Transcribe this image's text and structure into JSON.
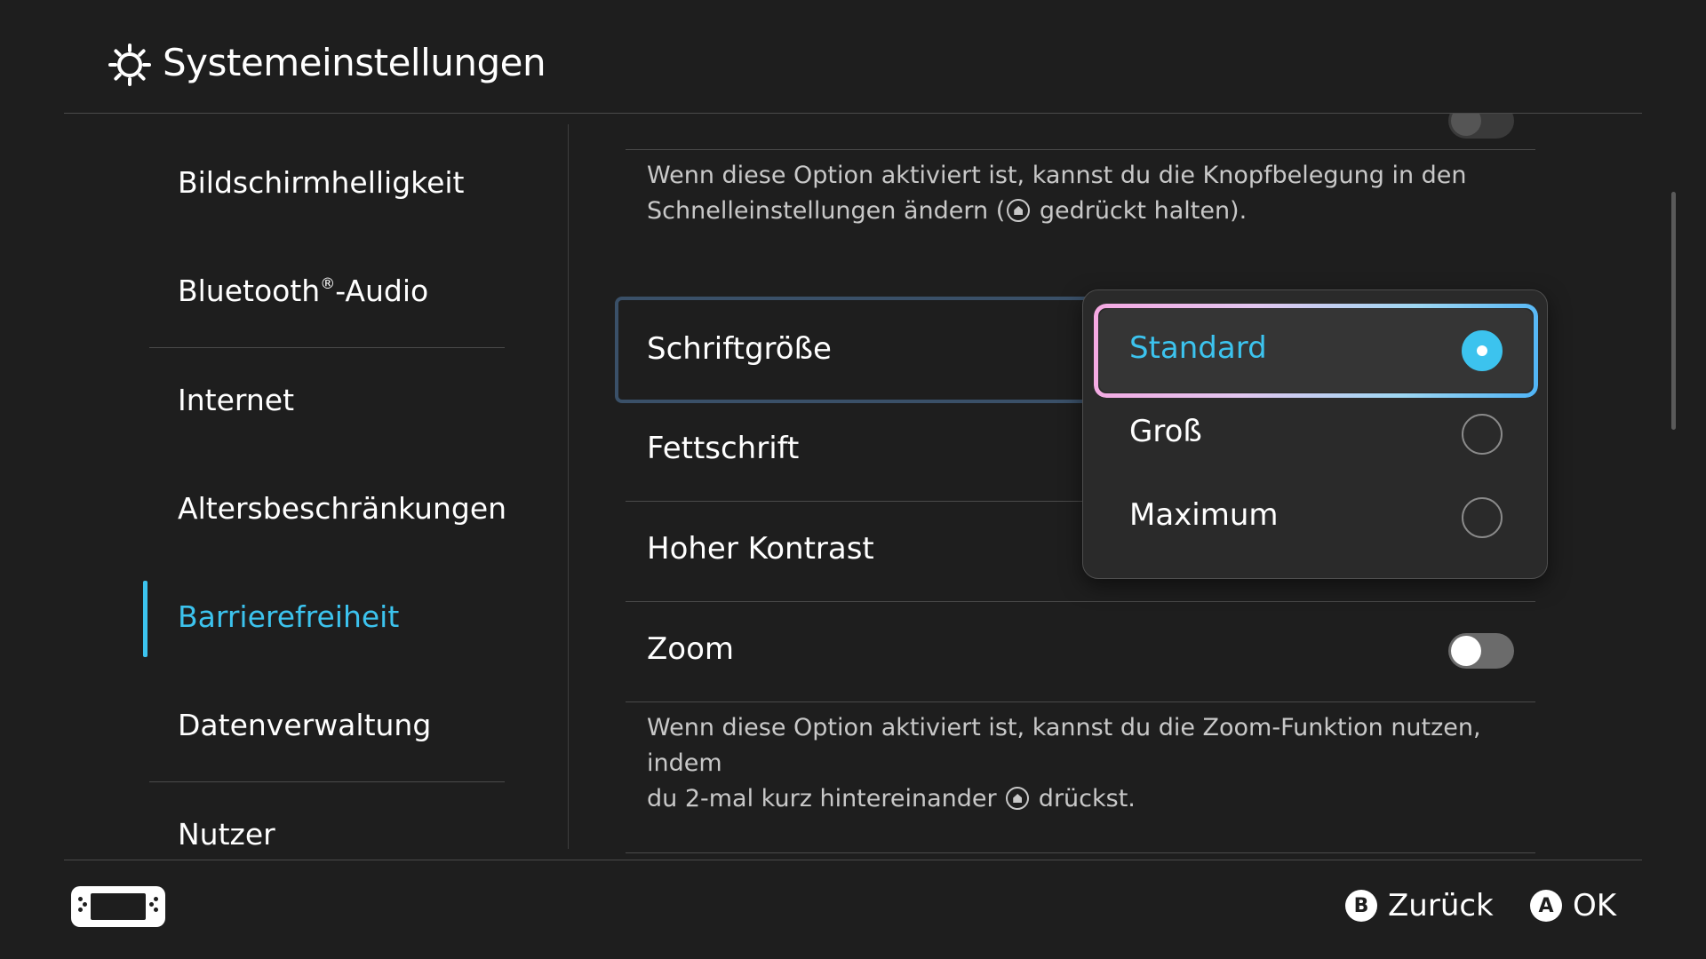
{
  "header": {
    "title": "Systemeinstellungen",
    "icon": "gear-icon"
  },
  "sidebar": {
    "items": [
      {
        "label": "Bildschirmhelligkeit",
        "active": false
      },
      {
        "label": "Bluetooth",
        "suffix": "-Audio",
        "sup": "®",
        "active": false
      },
      {
        "label": "Internet",
        "active": false
      },
      {
        "label": "Altersbeschränkungen",
        "active": false
      },
      {
        "label": "Barrierefreiheit",
        "active": true
      },
      {
        "label": "Datenverwaltung",
        "active": false
      },
      {
        "label": "Nutzer",
        "active": false
      }
    ]
  },
  "main": {
    "button_mapping_desc_1": "Wenn diese Option aktiviert ist, kannst du die Knopfbelegung in den",
    "button_mapping_desc_2a": "Schnelleinstellungen ändern (",
    "button_mapping_desc_2b": " gedrückt halten).",
    "rows": [
      {
        "label": "Schriftgröße"
      },
      {
        "label": "Fettschrift"
      },
      {
        "label": "Hoher Kontrast"
      },
      {
        "label": "Zoom",
        "toggle": false
      }
    ],
    "zoom_desc_1": "Wenn diese Option aktiviert ist, kannst du die Zoom-Funktion nutzen, indem",
    "zoom_desc_2a": "du 2-mal kurz hintereinander ",
    "zoom_desc_2b": " drückst."
  },
  "dropdown": {
    "options": [
      {
        "label": "Standard",
        "selected": true
      },
      {
        "label": "Groß",
        "selected": false
      },
      {
        "label": "Maximum",
        "selected": false
      }
    ]
  },
  "footer": {
    "back_key": "B",
    "back_label": "Zurück",
    "ok_key": "A",
    "ok_label": "OK"
  },
  "colors": {
    "accent": "#3cc3ee",
    "background": "#1e1e1e",
    "divider": "#4a4a4a"
  }
}
